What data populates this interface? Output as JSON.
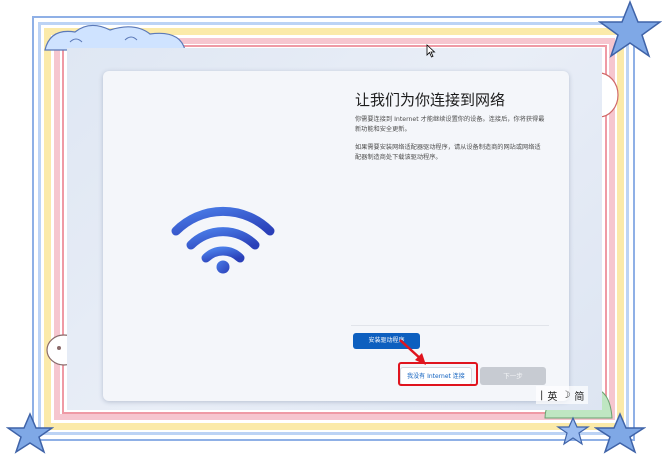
{
  "setup": {
    "title": "让我们为你连接到网络",
    "description_1": "你需要连接到 Internet 才能继续设置你的设备。连接后，你将获得最新功能和安全更新。",
    "description_2": "如果需要安装网络适配器驱动程序，请从设备制造商的网站或网络适配器制造商处下载该驱动程序。",
    "install_driver_label": "安装驱动程序",
    "no_internet_label": "我没有 Internet 连接",
    "next_label": "下一步"
  },
  "ime": {
    "separator": "|",
    "lang": "英",
    "mode_icon": "moon-icon",
    "mode_glyph": "☽",
    "script": "简"
  },
  "colors": {
    "accent": "#0d5fbf",
    "highlight": "#e0141e",
    "wifi": "#3a5fd6"
  }
}
